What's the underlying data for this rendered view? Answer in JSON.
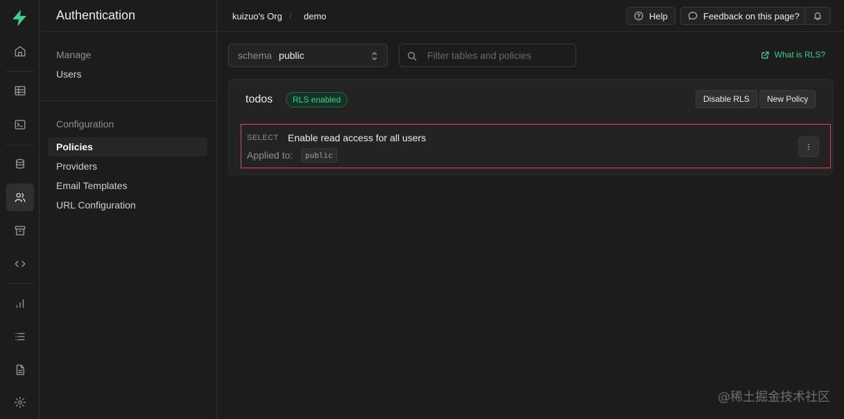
{
  "rail": {
    "logo": "supabase-logo-icon",
    "accent": "#3ecf8e",
    "items": [
      {
        "name": "home-icon"
      },
      {
        "name": "table-editor-icon"
      },
      {
        "name": "sql-editor-icon"
      },
      {
        "name": "database-icon"
      },
      {
        "name": "authentication-icon",
        "active": true
      },
      {
        "name": "storage-icon"
      },
      {
        "name": "edge-functions-icon"
      },
      {
        "name": "reports-icon"
      },
      {
        "name": "logs-icon"
      },
      {
        "name": "api-docs-icon"
      },
      {
        "name": "settings-icon"
      }
    ]
  },
  "sidebar": {
    "title": "Authentication",
    "groups": [
      {
        "title": "Manage",
        "items": [
          {
            "label": "Users"
          }
        ]
      },
      {
        "title": "Configuration",
        "items": [
          {
            "label": "Policies",
            "active": true
          },
          {
            "label": "Providers"
          },
          {
            "label": "Email Templates"
          },
          {
            "label": "URL Configuration"
          }
        ]
      }
    ]
  },
  "topbar": {
    "org": "kuizuo's Org",
    "project": "demo",
    "separator": "/",
    "help_label": "Help",
    "feedback_label": "Feedback on this page?"
  },
  "toolbar": {
    "schema_label": "schema",
    "schema_value": "public",
    "filter_placeholder": "Filter tables and policies",
    "rls_link_label": "What is RLS?"
  },
  "table": {
    "name": "todos",
    "badge": "RLS enabled",
    "disable_rls_label": "Disable RLS",
    "new_policy_label": "New Policy",
    "policies": [
      {
        "command": "SELECT",
        "name": "Enable read access for all users",
        "applied_label": "Applied to:",
        "role": "public"
      }
    ]
  },
  "watermark": "@稀土掘金技术社区"
}
